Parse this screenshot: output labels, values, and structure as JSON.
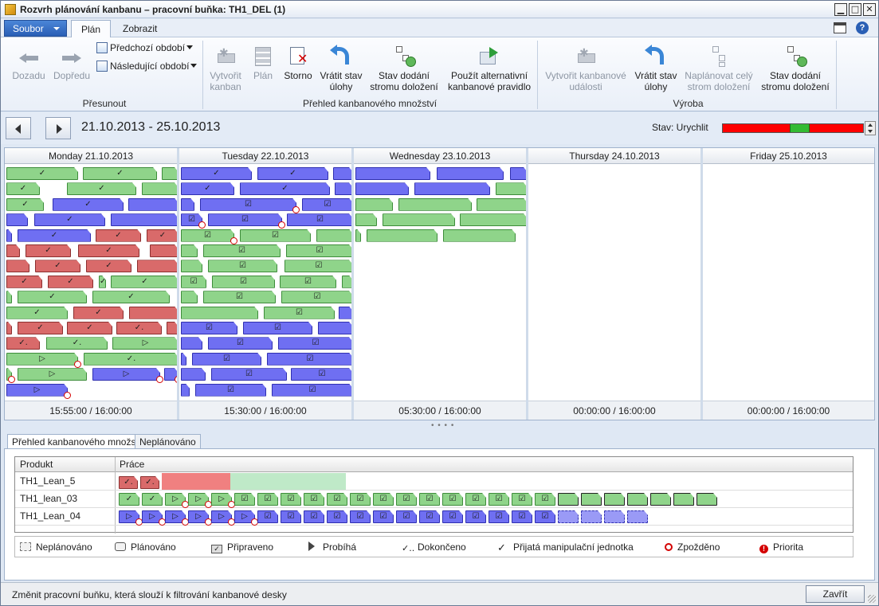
{
  "window": {
    "title": "Rozvrh plánování kanbanu – pracovní buňka: TH1_DEL (1)",
    "min": "▁",
    "max": "□",
    "close": "✕"
  },
  "menu": {
    "file": "Soubor",
    "tabs": [
      "Plán",
      "Zobrazit"
    ]
  },
  "ribbon": {
    "back": "Dozadu",
    "forward": "Dopředu",
    "prev_period": "Předchozí období",
    "next_period": "Následující období",
    "group_move": "Přesunout",
    "create_kanban": "Vytvořit kanban",
    "plan": "Plán",
    "cancel": "Storno",
    "revert_1": "Vrátit stav úlohy",
    "bom_1": "Stav dodání stromu doložení",
    "alt_rule": "Použít alternativní kanbanové pravidlo",
    "group_overview": "Přehled kanbanového množství",
    "create_event": "Vytvořit kanbanové události",
    "revert_2": "Vrátit stav úlohy",
    "schedule_tree": "Naplánovat celý strom doložení",
    "bom_2": "Stav dodání stromu doložení",
    "group_production": "Výroba"
  },
  "nav": {
    "range": "21.10.2013 - 25.10.2013",
    "status_label": "Stav: Urychlit",
    "status_green_fraction": [
      0.48,
      0.62
    ]
  },
  "days": [
    {
      "header": "Monday 21.10.2013",
      "footer": "15:55:00 / 16:00:00"
    },
    {
      "header": "Tuesday 22.10.2013",
      "footer": "15:30:00 / 16:00:00"
    },
    {
      "header": "Wednesday 23.10.2013",
      "footer": "05:30:00 / 16:00:00"
    },
    {
      "header": "Thursday 24.10.2013",
      "footer": "00:00:00 / 16:00:00"
    },
    {
      "header": "Friday 25.10.2013",
      "footer": "00:00:00 / 16:00:00"
    }
  ],
  "lower_tabs": [
    "Přehled kanbanového množství",
    "Neplánováno"
  ],
  "overview": {
    "col_product": "Produkt",
    "col_work": "Práce",
    "rows": [
      {
        "product": "TH1_Lean_5"
      },
      {
        "product": "TH1_lean_03"
      },
      {
        "product": "TH1_Lean_04"
      }
    ]
  },
  "legend": [
    "Neplánováno",
    "Plánováno",
    "Připraveno",
    "Probíhá",
    "Dokončeno",
    "Přijatá manipulační jednotka",
    "Zpožděno",
    "Priorita"
  ],
  "status": {
    "text": "Změnit pracovní buňku, která slouží k filtrování kanbanové desky",
    "close": "Zavřít"
  },
  "colors": {
    "green": "#8fd48a",
    "blue": "#6f6ff2",
    "red": "#d96a6a",
    "status_red": "#ff0000",
    "status_green": "#33bb33"
  }
}
